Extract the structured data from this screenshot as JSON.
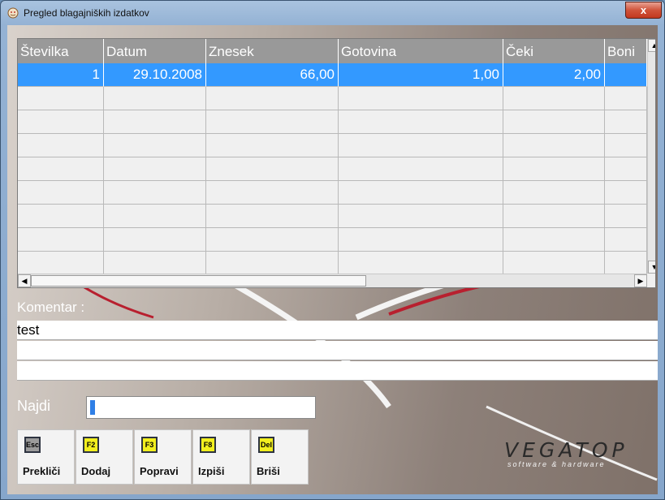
{
  "window": {
    "title": "Pregled blagajniških izdatkov",
    "close_label": "x"
  },
  "grid": {
    "columns": [
      "Številka",
      "Datum",
      "Znesek",
      "Gotovina",
      "Čeki",
      "Boni"
    ],
    "rows": [
      [
        "1",
        "29.10.2008",
        "66,00",
        "1,00",
        "2,00",
        ""
      ]
    ],
    "selected_row": 0
  },
  "comment": {
    "label": "Komentar :",
    "lines": [
      "test",
      "",
      ""
    ]
  },
  "search": {
    "label": "Najdi",
    "value": ""
  },
  "buttons": [
    {
      "key": "Esc",
      "label": "Prekliči",
      "key_color": "#9b9b9b"
    },
    {
      "key": "F2",
      "label": "Dodaj",
      "key_color": "#f2ef1e"
    },
    {
      "key": "F3",
      "label": "Popravi",
      "key_color": "#f2ef1e"
    },
    {
      "key": "F8",
      "label": "Izpiši",
      "key_color": "#f2ef1e"
    },
    {
      "key": "Del",
      "label": "Briši",
      "key_color": "#f2ef1e"
    }
  ],
  "logo": {
    "name": "VEGATOP",
    "tagline": "software & hardware"
  },
  "colors": {
    "selection": "#3399ff",
    "header": "#999999",
    "close": "#c94a32"
  }
}
